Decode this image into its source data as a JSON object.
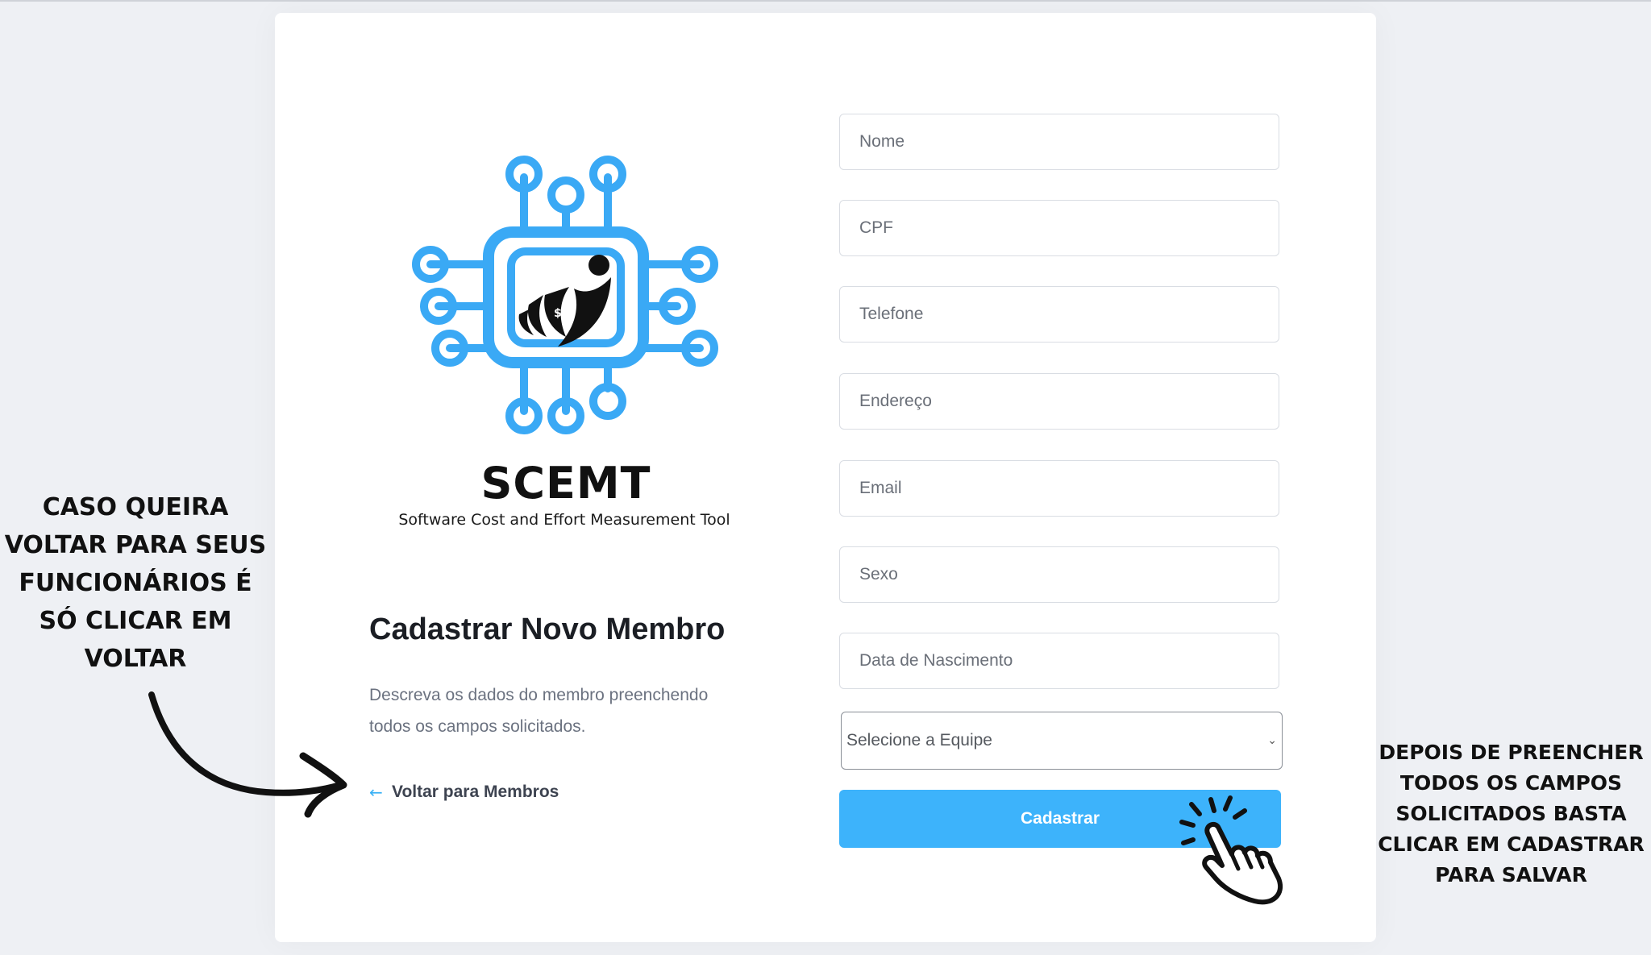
{
  "brand": {
    "name": "SCEMT",
    "tagline": "Software Cost and Effort Measurement Tool"
  },
  "intro": {
    "title": "Cadastrar Novo Membro",
    "description": "Descreva os dados do membro preenchendo todos os campos solicitados.",
    "back_link": "Voltar para Membros"
  },
  "form": {
    "fields": {
      "nome": "Nome",
      "cpf": "CPF",
      "telefone": "Telefone",
      "endereco": "Endereço",
      "email": "Email",
      "sexo": "Sexo",
      "nascimento": "Data de Nascimento"
    },
    "team_select": {
      "selected": "Selecione a Equipe"
    },
    "submit_label": "Cadastrar"
  },
  "annotations": {
    "left": "Caso queira voltar para seus funcionários é só clicar em voltar",
    "right": "Depois de preencher todos os campos solicitados basta clicar em cadastrar para salvar"
  },
  "colors": {
    "accent": "#3db3fb",
    "logo_blue": "#3aa9f5",
    "page_background": "#eef0f4",
    "card_background": "#ffffff"
  },
  "icons": {
    "back": "arrow-left-icon",
    "select": "chevron-down-icon",
    "annotation_arrow": "curved-arrow-icon",
    "pointer": "pointing-hand-click-icon"
  }
}
